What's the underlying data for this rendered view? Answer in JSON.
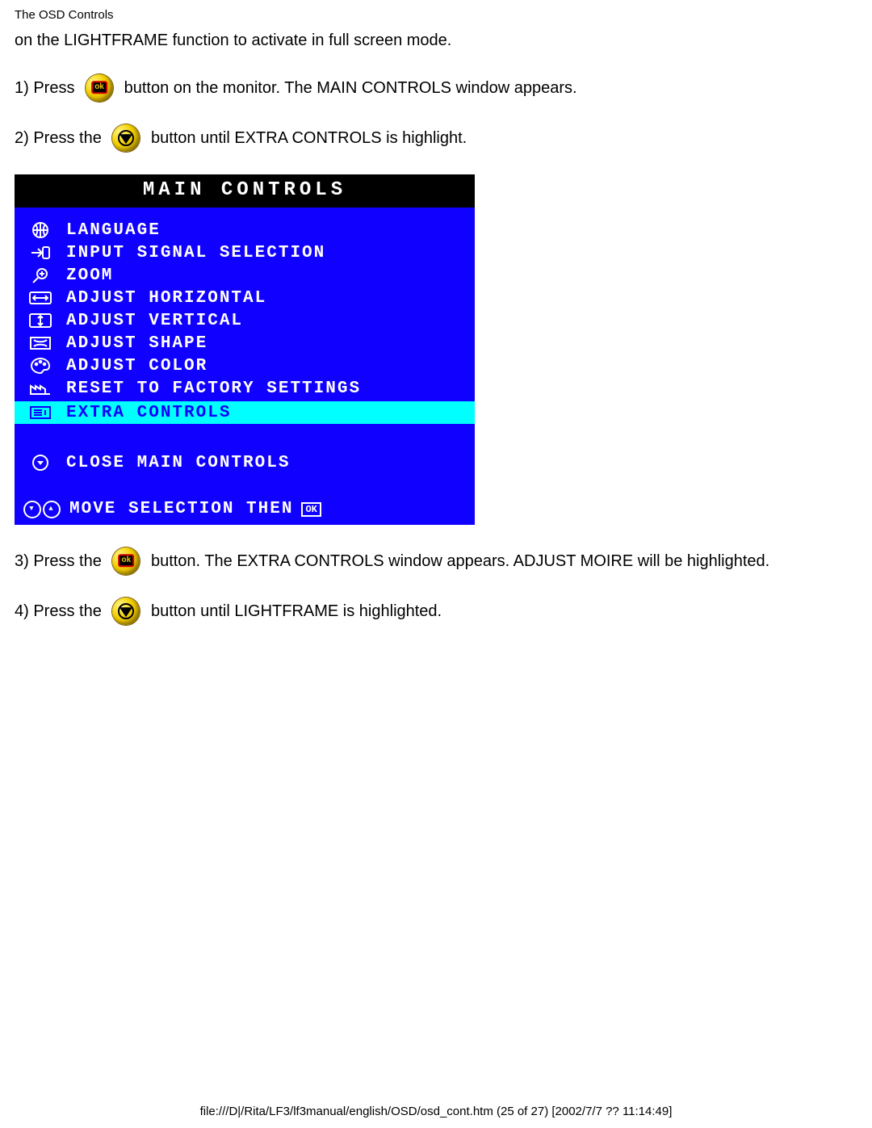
{
  "header": {
    "title": "The OSD Controls"
  },
  "intro": "on the LIGHTFRAME function to activate in full screen mode.",
  "steps": {
    "s1a": "1) Press ",
    "s1b": " button on the monitor. The MAIN CONTROLS window appears.",
    "s2a": "2) Press the ",
    "s2b": " button until EXTRA CONTROLS is highlight.",
    "s3a": "3) Press the ",
    "s3b": " button. The EXTRA CONTROLS window appears. ADJUST MOIRE will be highlighted.",
    "s4a": "4) Press the ",
    "s4b": " button until LIGHTFRAME is highlighted."
  },
  "osd": {
    "title": "MAIN CONTROLS",
    "items": [
      {
        "label": "LANGUAGE",
        "icon": "globe"
      },
      {
        "label": "INPUT SIGNAL SELECTION",
        "icon": "input"
      },
      {
        "label": "ZOOM",
        "icon": "zoom"
      },
      {
        "label": "ADJUST HORIZONTAL",
        "icon": "horiz"
      },
      {
        "label": "ADJUST VERTICAL",
        "icon": "vert"
      },
      {
        "label": "ADJUST SHAPE",
        "icon": "shape"
      },
      {
        "label": "ADJUST COLOR",
        "icon": "palette"
      },
      {
        "label": "RESET TO FACTORY SETTINGS",
        "icon": "factory"
      },
      {
        "label": "EXTRA CONTROLS",
        "icon": "extra",
        "highlight": true
      }
    ],
    "close": {
      "label": "CLOSE MAIN CONTROLS",
      "icon": "close-down"
    },
    "footer": {
      "label": "MOVE SELECTION THEN",
      "ok": "OK"
    }
  },
  "footer": "file:///D|/Rita/LF3/lf3manual/english/OSD/osd_cont.htm (25 of 27) [2002/7/7 ?? 11:14:49]"
}
